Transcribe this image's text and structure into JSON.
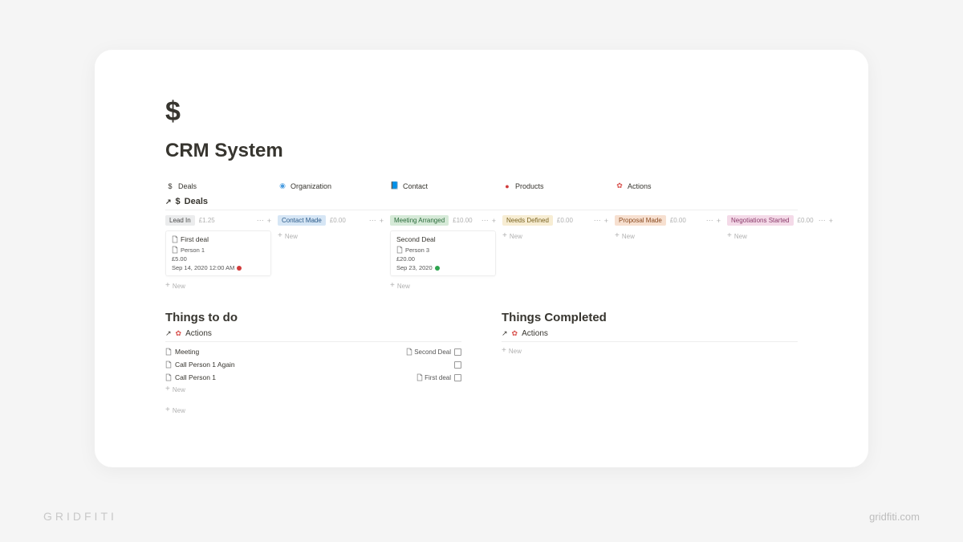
{
  "page": {
    "icon": "$",
    "title": "CRM System"
  },
  "nav": [
    {
      "icon": "$",
      "label": "Deals",
      "color": "#37352f"
    },
    {
      "icon": "◉",
      "label": "Organization",
      "color": "#4a9de0"
    },
    {
      "icon": "📘",
      "label": "Contact",
      "color": "#3a6fd8"
    },
    {
      "icon": "●",
      "label": "Products",
      "color": "#d13b3b"
    },
    {
      "icon": "✿",
      "label": "Actions",
      "color": "#d9534f"
    }
  ],
  "linked_deals": {
    "icon": "$",
    "title": "Deals"
  },
  "board": {
    "columns": [
      {
        "name": "Lead In",
        "tag_class": "tag-gray",
        "sum": "£1.25",
        "cards": [
          {
            "has_doc_icon": true,
            "title": "First deal",
            "person": "Person 1",
            "amount": "£5.00",
            "date": "Sep 14, 2020 12:00 AM",
            "dot": "red"
          }
        ]
      },
      {
        "name": "Contact Made",
        "tag_class": "tag-blue",
        "sum": "£0.00",
        "cards": []
      },
      {
        "name": "Meeting Arranged",
        "tag_class": "tag-green",
        "sum": "£10.00",
        "cards": [
          {
            "has_doc_icon": false,
            "title": "Second Deal",
            "person": "Person 3",
            "amount": "£20.00",
            "date": "Sep 23, 2020",
            "dot": "green"
          }
        ]
      },
      {
        "name": "Needs Defined",
        "tag_class": "tag-yellow",
        "sum": "£0.00",
        "cards": []
      },
      {
        "name": "Proposal Made",
        "tag_class": "tag-orange",
        "sum": "£0.00",
        "cards": []
      },
      {
        "name": "Negotiations Started",
        "tag_class": "tag-pink",
        "sum": "£0.00",
        "cards": []
      }
    ],
    "new_label": "New"
  },
  "sections": {
    "todo": {
      "title": "Things to do",
      "actions_label": "Actions",
      "rows": [
        {
          "name": "Meeting",
          "related": "Second Deal",
          "checkbox": true
        },
        {
          "name": "Call Person 1 Again",
          "related": "",
          "checkbox": true
        },
        {
          "name": "Call Person 1",
          "related": "First deal",
          "checkbox": true
        }
      ],
      "new_label": "New"
    },
    "done": {
      "title": "Things Completed",
      "actions_label": "Actions",
      "new_label": "New"
    }
  },
  "footer": {
    "brand": "GRIDFITI",
    "url": "gridfiti.com"
  }
}
